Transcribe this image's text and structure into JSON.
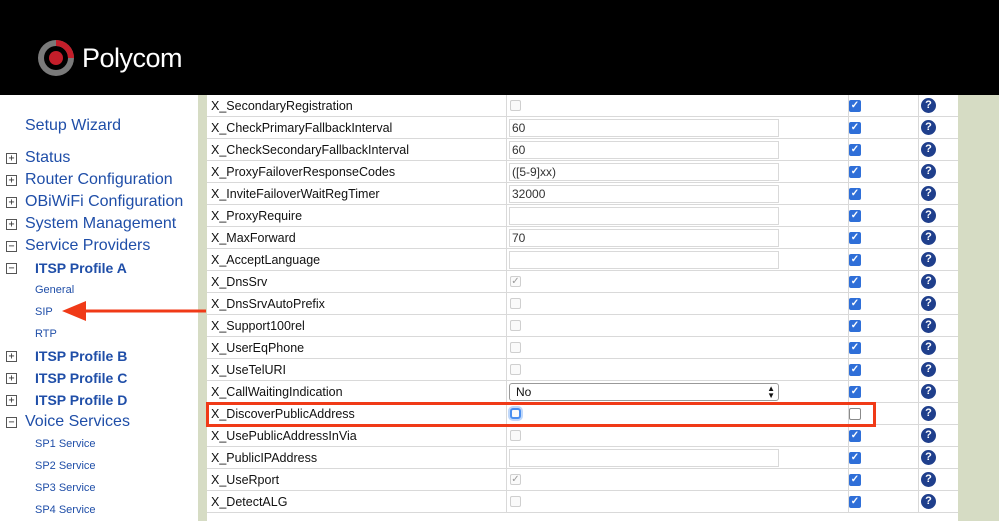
{
  "brand": {
    "name": "Polycom"
  },
  "sidebar": {
    "wizard": "Setup Wizard",
    "items": [
      {
        "label": "Status",
        "toggle": "+",
        "level": 1
      },
      {
        "label": "Router Configuration",
        "toggle": "+",
        "level": 1
      },
      {
        "label": "OBiWiFi Configuration",
        "toggle": "+",
        "level": 1
      },
      {
        "label": "System Management",
        "toggle": "+",
        "level": 1
      },
      {
        "label": "Service Providers",
        "toggle": "−",
        "level": 1
      },
      {
        "label": "ITSP Profile A",
        "toggle": "−",
        "level": 2
      },
      {
        "label": "General",
        "toggle": "",
        "level": 3
      },
      {
        "label": "SIP",
        "toggle": "",
        "level": 3
      },
      {
        "label": "RTP",
        "toggle": "",
        "level": 3
      },
      {
        "label": "ITSP Profile B",
        "toggle": "+",
        "level": 2
      },
      {
        "label": "ITSP Profile C",
        "toggle": "+",
        "level": 2
      },
      {
        "label": "ITSP Profile D",
        "toggle": "+",
        "level": 2
      },
      {
        "label": "Voice Services",
        "toggle": "−",
        "level": 1
      },
      {
        "label": "SP1 Service",
        "toggle": "",
        "level": 3
      },
      {
        "label": "SP2 Service",
        "toggle": "",
        "level": 3
      },
      {
        "label": "SP3 Service",
        "toggle": "",
        "level": 3
      },
      {
        "label": "SP4 Service",
        "toggle": "",
        "level": 3
      }
    ]
  },
  "table": {
    "rows": [
      {
        "name": "X_SecondaryRegistration",
        "type": "checkbox",
        "value": "",
        "checked": false,
        "default": true
      },
      {
        "name": "X_CheckPrimaryFallbackInterval",
        "type": "text",
        "value": "60",
        "default": true
      },
      {
        "name": "X_CheckSecondaryFallbackInterval",
        "type": "text",
        "value": "60",
        "default": true
      },
      {
        "name": "X_ProxyFailoverResponseCodes",
        "type": "text",
        "value": "([5-9]xx)",
        "default": true
      },
      {
        "name": "X_InviteFailoverWaitRegTimer",
        "type": "text",
        "value": "32000",
        "default": true
      },
      {
        "name": "X_ProxyRequire",
        "type": "text",
        "value": "",
        "default": true
      },
      {
        "name": "X_MaxForward",
        "type": "text",
        "value": "70",
        "default": true
      },
      {
        "name": "X_AcceptLanguage",
        "type": "text",
        "value": "",
        "default": true
      },
      {
        "name": "X_DnsSrv",
        "type": "checkbox",
        "value": "",
        "checked": true,
        "default": true
      },
      {
        "name": "X_DnsSrvAutoPrefix",
        "type": "checkbox",
        "value": "",
        "checked": false,
        "default": true
      },
      {
        "name": "X_Support100rel",
        "type": "checkbox",
        "value": "",
        "checked": false,
        "default": true
      },
      {
        "name": "X_UserEqPhone",
        "type": "checkbox",
        "value": "",
        "checked": false,
        "default": true
      },
      {
        "name": "X_UseTelURI",
        "type": "checkbox",
        "value": "",
        "checked": false,
        "default": true
      },
      {
        "name": "X_CallWaitingIndication",
        "type": "select",
        "value": "No",
        "default": true
      },
      {
        "name": "X_DiscoverPublicAddress",
        "type": "checkbox",
        "value": "",
        "checked": false,
        "focused": true,
        "default": false
      },
      {
        "name": "X_UsePublicAddressInVia",
        "type": "checkbox",
        "value": "",
        "checked": false,
        "default": true
      },
      {
        "name": "X_PublicIPAddress",
        "type": "text",
        "value": "",
        "default": true
      },
      {
        "name": "X_UseRport",
        "type": "checkbox",
        "value": "",
        "checked": true,
        "default": true
      },
      {
        "name": "X_DetectALG",
        "type": "checkbox",
        "value": "",
        "checked": false,
        "default": true
      }
    ],
    "help_glyph": "?",
    "check_glyph": "✓"
  },
  "colors": {
    "header_bg": "#000000",
    "link": "#1f4ea8",
    "highlight": "#f03a17",
    "band": "#d6dcc4",
    "default_check": "#2f6fd8"
  }
}
